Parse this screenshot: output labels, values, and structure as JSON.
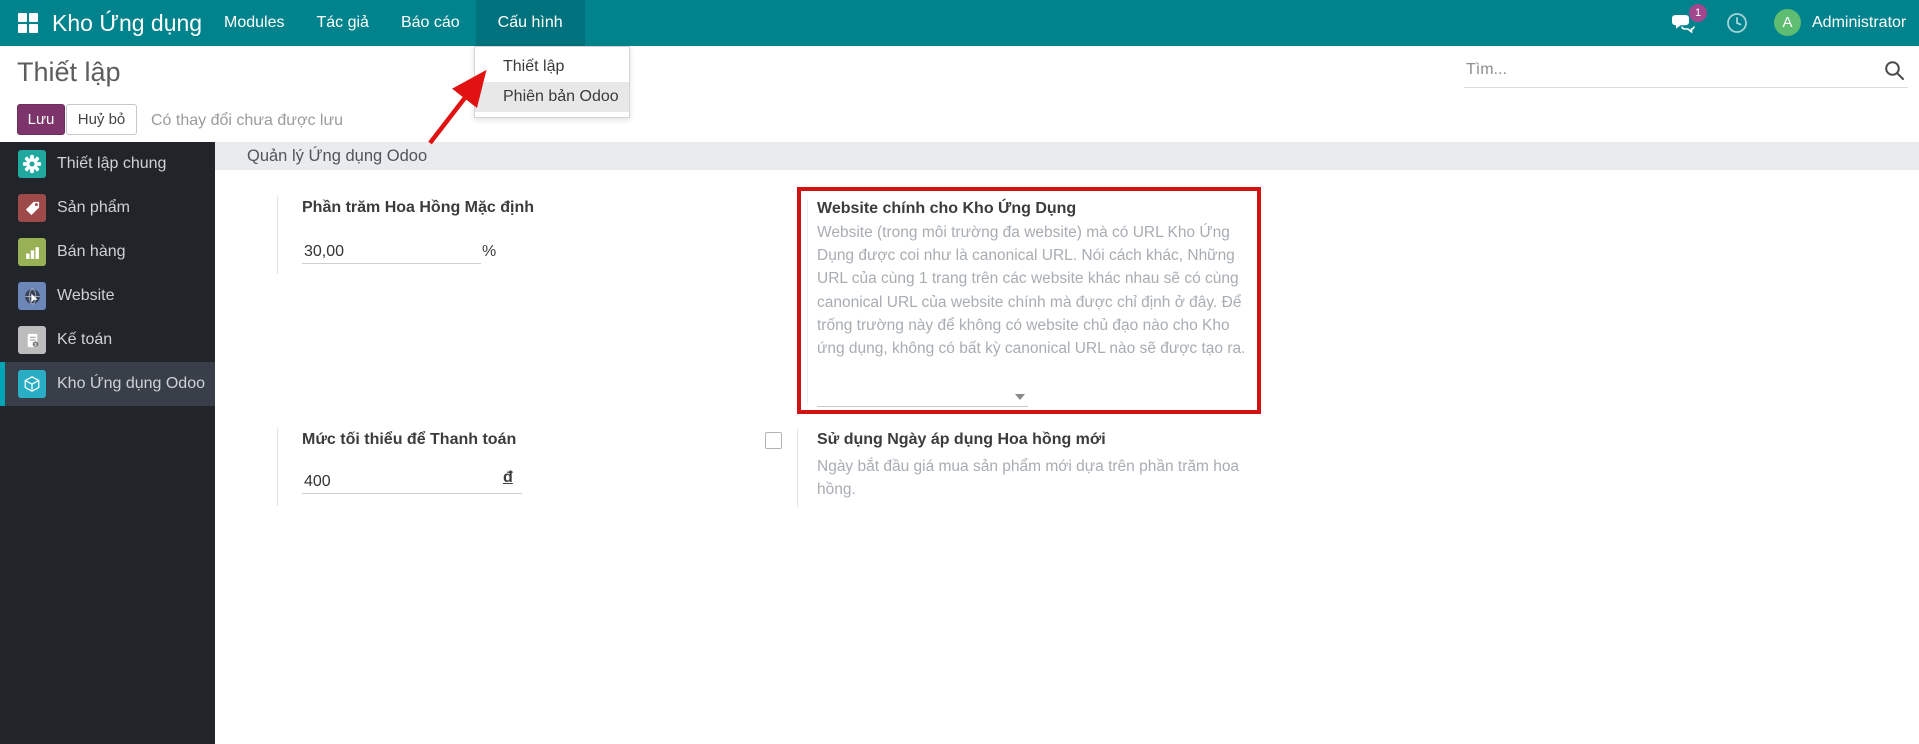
{
  "navbar": {
    "app_name": "Kho Ứng dụng",
    "menu": [
      "Modules",
      "Tác giả",
      "Báo cáo",
      "Cấu hình"
    ],
    "active_menu": "Cấu hình",
    "messages_count": "1",
    "user": {
      "initial": "A",
      "name": "Administrator"
    }
  },
  "config_dropdown": {
    "items": [
      "Thiết lập",
      "Phiên bản Odoo"
    ]
  },
  "control_panel": {
    "title": "Thiết lập",
    "save": "Lưu",
    "discard": "Huỷ bỏ",
    "unsaved": "Có thay đổi chưa được lưu",
    "search_placeholder": "Tìm..."
  },
  "sidebar": {
    "items": [
      {
        "label": "Thiết lập chung",
        "icon": "gear-icon",
        "color": "#1ea89e"
      },
      {
        "label": "Sản phẩm",
        "icon": "tag-icon",
        "color": "#9e4a4a"
      },
      {
        "label": "Bán hàng",
        "icon": "bar-chart-icon",
        "color": "#99b155"
      },
      {
        "label": "Website",
        "icon": "globe-cursor-icon",
        "color": "#6d86ba"
      },
      {
        "label": "Kế toán",
        "icon": "invoice-icon",
        "color": "#bcbcbc"
      },
      {
        "label": "Kho Ứng dụng Odoo",
        "icon": "cube-icon",
        "color": "#2aaec6",
        "selected": true
      }
    ]
  },
  "settings": {
    "section_title": "Quản lý Ứng dụng Odoo",
    "commission": {
      "label": "Phần trăm Hoa Hồng Mặc định",
      "value": "30,00",
      "suffix": "%"
    },
    "main_website": {
      "label": "Website chính cho Kho Ứng Dụng",
      "description": "Website (trong môi trường đa website) mà có URL Kho Ứng Dụng được coi như là canonical URL. Nói cách khác, Những URL của cùng 1 trang trên các website khác nhau sẽ có cùng canonical URL của website chính mà được chỉ định ở đây. Để trống trường này để không có website chủ đạo nào cho Kho ứng dụng, không có bất kỳ canonical URL nào sẽ được tạo ra.",
      "value": "",
      "highlighted": true
    },
    "min_payout": {
      "label": "Mức tối thiểu để Thanh toán",
      "value": "400",
      "suffix": "đ"
    },
    "new_commission_date": {
      "label": "Sử dụng Ngày áp dụng Hoa hồng mới",
      "description": "Ngày bắt đầu giá mua sản phẩm mới dựa trên phần trăm hoa hồng.",
      "checked": false
    }
  },
  "colors": {
    "navbar": "#00838d",
    "navbar_active": "#00727d",
    "save_button": "#7c346a",
    "sidebar_bg": "#212429",
    "sidebar_selected": "#383f48",
    "sidebar_selected_bar": "#00a6b8",
    "section_bar": "#e9ebee",
    "highlight_border": "#d01212",
    "annotation_arrow": "#e01212",
    "badge": "#a2478d",
    "avatar": "#5fbd71"
  }
}
